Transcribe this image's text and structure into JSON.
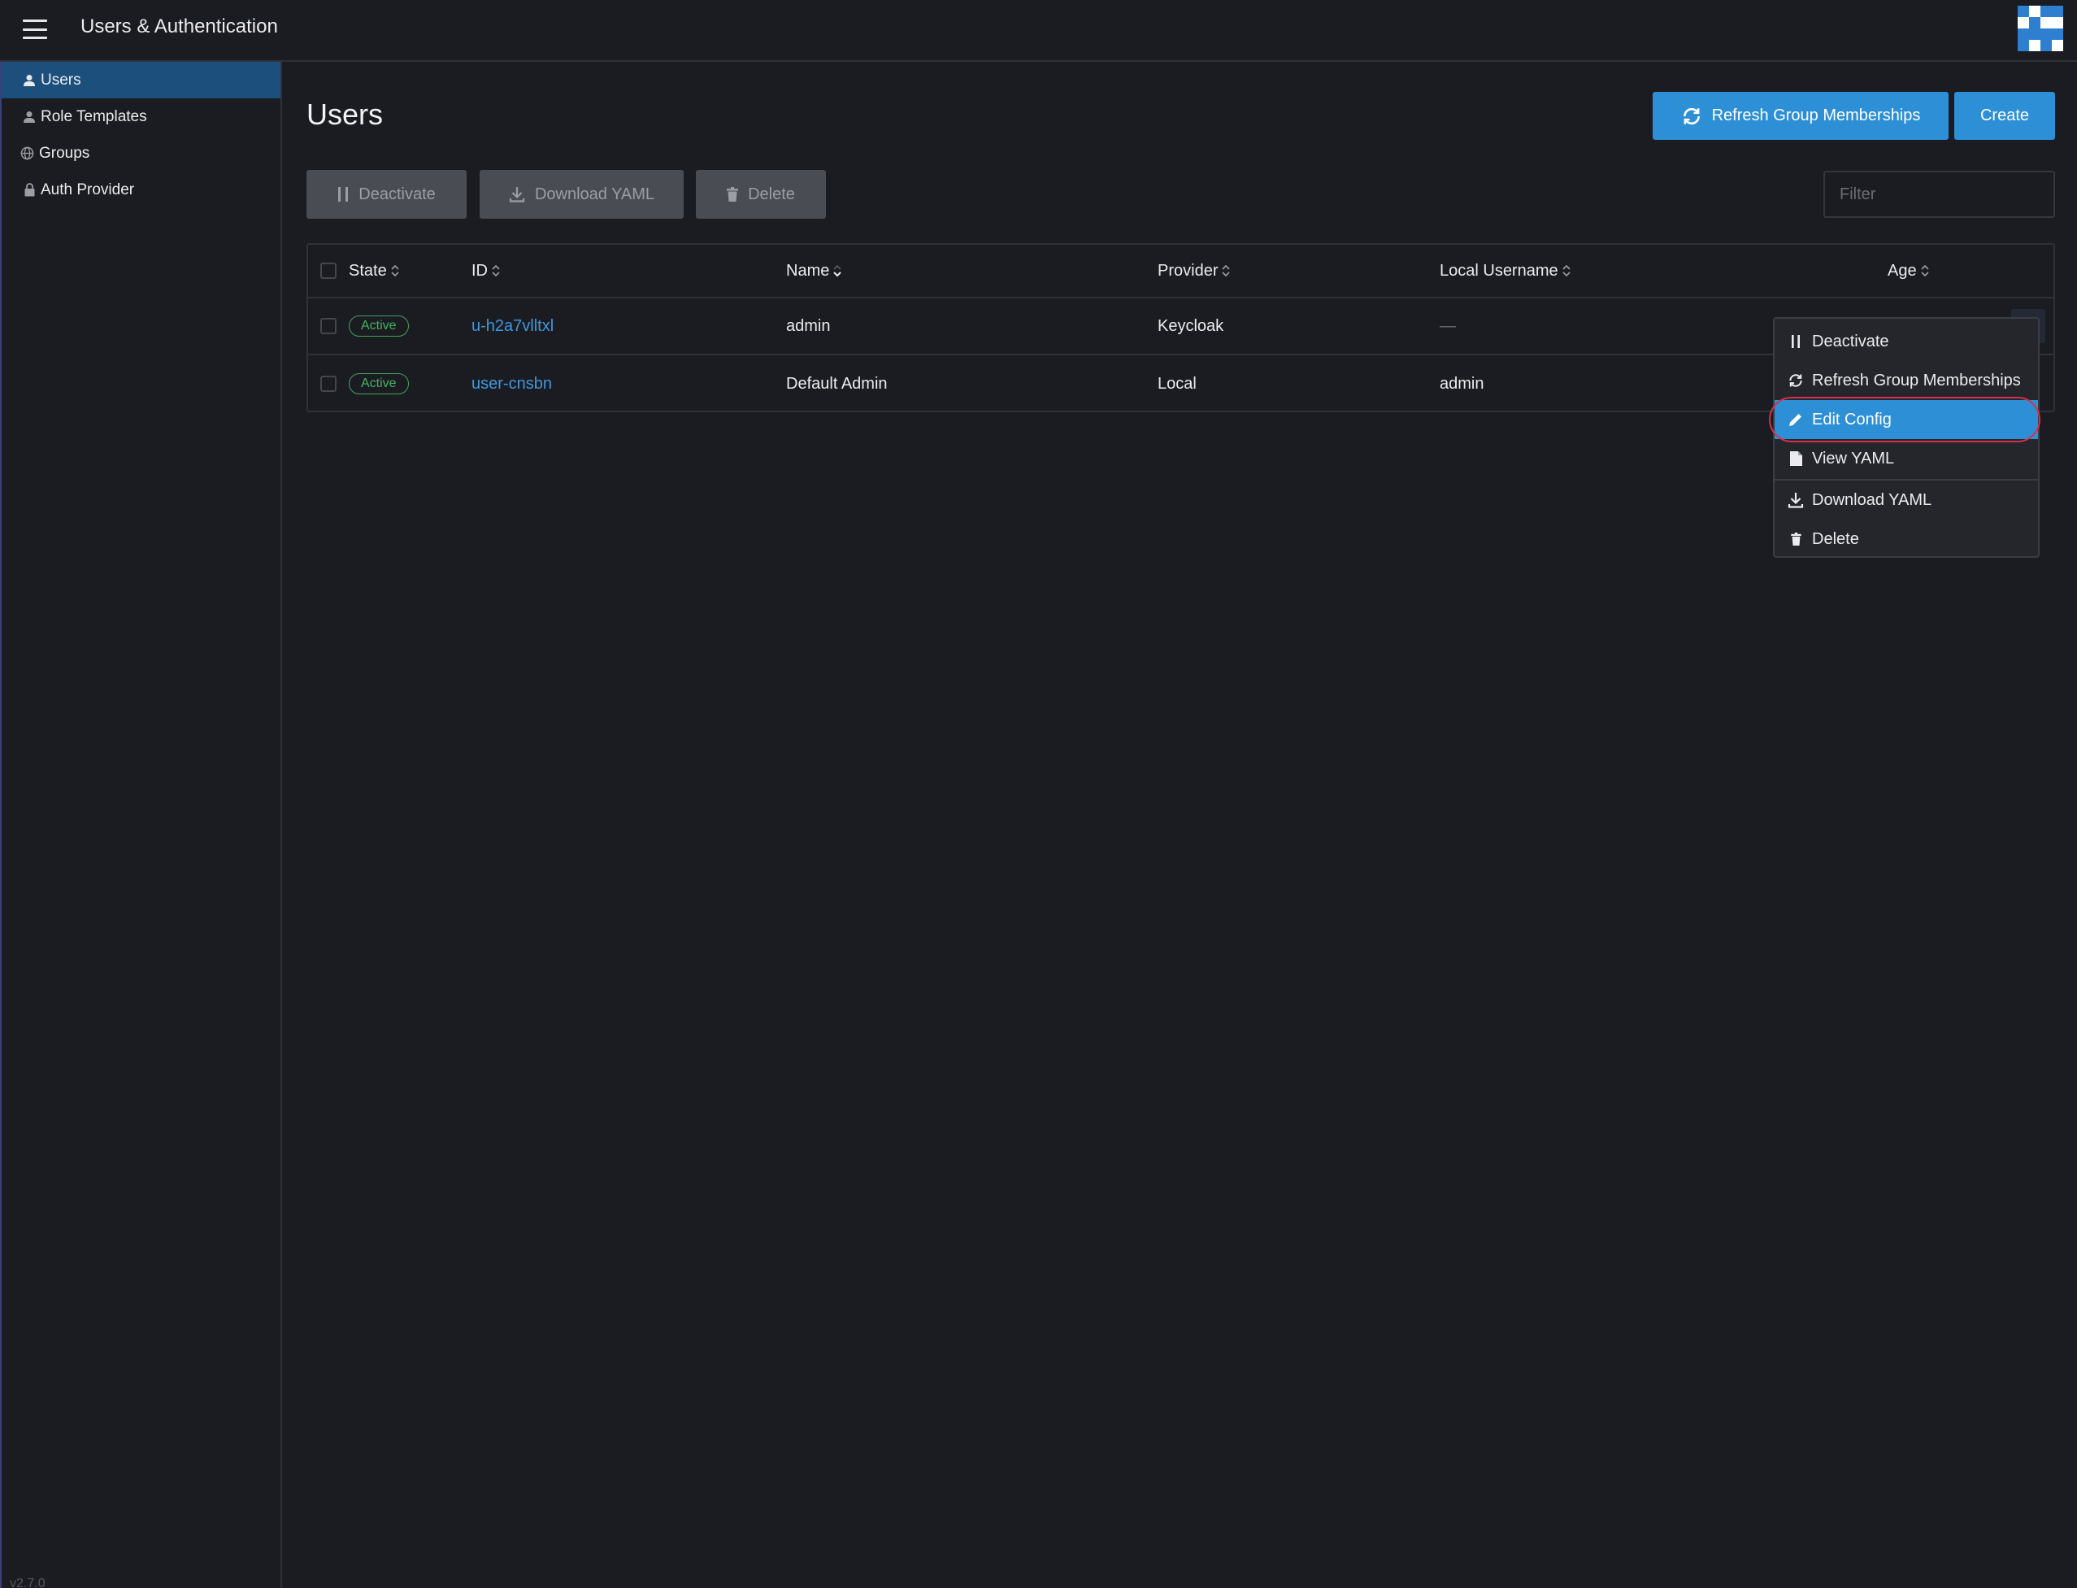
{
  "header": {
    "app_title": "Users & Authentication",
    "logo_colors": [
      "#2f7fd0",
      "#ffffff"
    ]
  },
  "sidebar": {
    "items": [
      {
        "label": "Users",
        "icon": "user-icon",
        "active": true
      },
      {
        "label": "Role Templates",
        "icon": "user-icon",
        "active": false
      },
      {
        "label": "Groups",
        "icon": "globe-icon",
        "active": false
      },
      {
        "label": "Auth Provider",
        "icon": "lock-icon",
        "active": false
      }
    ],
    "version": "v2.7.0"
  },
  "main": {
    "title": "Users",
    "refresh_button_label": "Refresh Group Memberships",
    "create_button_label": "Create",
    "bulk_actions": {
      "deactivate_label": "Deactivate",
      "download_yaml_label": "Download YAML",
      "delete_label": "Delete"
    },
    "filter": {
      "placeholder": "Filter",
      "value": ""
    }
  },
  "table": {
    "columns": [
      "State",
      "ID",
      "Name",
      "Provider",
      "Local Username",
      "Age"
    ],
    "rows": [
      {
        "state": "Active",
        "id": "u-h2a7vlltxl",
        "name": "admin",
        "provider": "Keycloak",
        "local_username": "—",
        "age": ""
      },
      {
        "state": "Active",
        "id": "user-cnsbn",
        "name": "Default Admin",
        "provider": "Local",
        "local_username": "admin",
        "age": ""
      }
    ]
  },
  "context_menu": {
    "items": [
      {
        "label": "Deactivate",
        "icon": "pause-icon"
      },
      {
        "label": "Refresh Group Memberships",
        "icon": "refresh-icon"
      },
      {
        "label": "Edit Config",
        "icon": "pencil-icon",
        "highlighted": true
      },
      {
        "label": "View YAML",
        "icon": "file-icon"
      },
      {
        "label": "Download YAML",
        "icon": "download-icon"
      },
      {
        "label": "Delete",
        "icon": "trash-icon"
      }
    ]
  },
  "colors": {
    "accent": "#2d8fd5",
    "active_badge": "#47b163",
    "sidebar_active": "#1d4f7c",
    "focus_ring": "#d6314a",
    "background": "#1b1c21"
  }
}
